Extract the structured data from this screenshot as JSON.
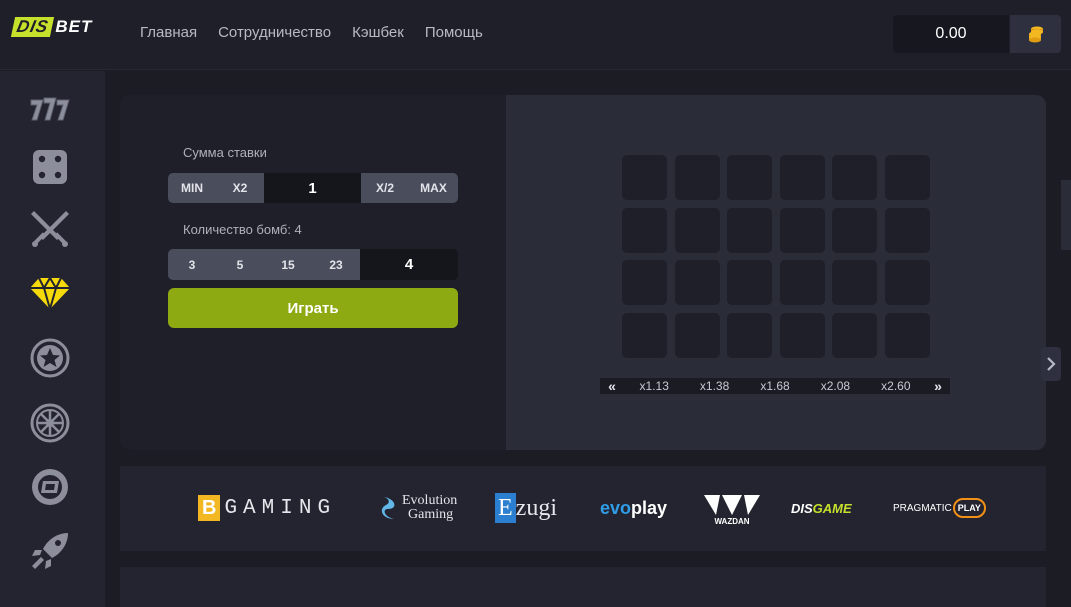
{
  "header": {
    "logo_left": "DIS",
    "logo_right": "BET",
    "nav": [
      "Главная",
      "Сотрудничество",
      "Кэшбек",
      "Помощь"
    ],
    "balance": "0.00"
  },
  "sidebar": {
    "items": [
      "slots-777-icon",
      "dice-icon",
      "crossed-swords-icon",
      "diamond-icon",
      "star-coin-icon",
      "wheel-icon",
      "coin-flip-icon",
      "rocket-icon"
    ],
    "active": "diamond-icon"
  },
  "controls": {
    "bet_label": "Сумма ставки",
    "min_label": "MIN",
    "x2_label": "X2",
    "bet_value": "1",
    "half_label": "X/2",
    "max_label": "MAX",
    "bombs_label": "Количество бомб: 4",
    "bomb_options": [
      "3",
      "5",
      "15",
      "23"
    ],
    "bombs_value": "4",
    "play_label": "Играть"
  },
  "board": {
    "rows": 4,
    "cols": 6,
    "prev_arrow": "«",
    "next_arrow": "»",
    "multipliers": [
      "x1.13",
      "x1.38",
      "x1.68",
      "x2.08",
      "x2.60"
    ]
  },
  "providers": {
    "bgaming_b": "B",
    "bgaming_rest": "GAMING",
    "evolution_line1": "Evolution",
    "evolution_line2": "Gaming",
    "ezugi_e": "E",
    "ezugi_rest": "zugi",
    "evoplay_evo": "evo",
    "evoplay_play": "play",
    "wazdan": "WAZDAN",
    "disgame_dis": "DIS",
    "disgame_game": "GAME",
    "pragmatic": "PRAGMATIC",
    "pragmatic_play": "PLAY"
  },
  "colors": {
    "accent": "#c6e02c",
    "play_button": "#8eaa12",
    "diamond": "#f5d90a"
  }
}
